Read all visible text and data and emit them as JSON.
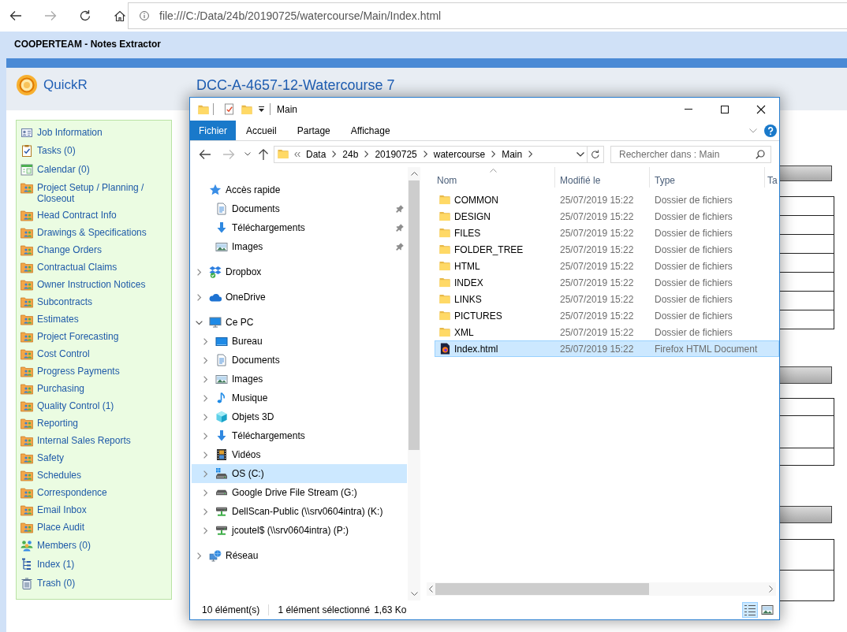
{
  "browser": {
    "url": "file:///C:/Data/24b/20190725/watercourse/Main/Index.html"
  },
  "app": {
    "title": "COOPERTEAM - Notes Extractor",
    "logo_text": "QuickR",
    "project_title": "DCC-A-4657-12-Watercourse 7"
  },
  "sidebar": {
    "items": [
      {
        "label": "Job Information",
        "kind": "job"
      },
      {
        "label": "Tasks (0)",
        "kind": "tasks"
      },
      {
        "label": "Calendar (0)",
        "kind": "calendar"
      },
      {
        "label": "Project Setup / Planning / Closeout",
        "kind": "module"
      },
      {
        "label": "Head Contract Info",
        "kind": "module"
      },
      {
        "label": "Drawings & Specifications",
        "kind": "module"
      },
      {
        "label": "Change Orders",
        "kind": "module"
      },
      {
        "label": "Contractual Claims",
        "kind": "module"
      },
      {
        "label": "Owner Instruction Notices",
        "kind": "module"
      },
      {
        "label": "Subcontracts",
        "kind": "module"
      },
      {
        "label": "Estimates",
        "kind": "module"
      },
      {
        "label": "Project Forecasting",
        "kind": "module"
      },
      {
        "label": "Cost Control",
        "kind": "module"
      },
      {
        "label": "Progress Payments",
        "kind": "module"
      },
      {
        "label": "Purchasing",
        "kind": "module"
      },
      {
        "label": "Quality Control (1)",
        "kind": "module"
      },
      {
        "label": "Reporting",
        "kind": "module"
      },
      {
        "label": "Internal Sales Reports",
        "kind": "module"
      },
      {
        "label": "Safety",
        "kind": "module"
      },
      {
        "label": "Schedules",
        "kind": "module"
      },
      {
        "label": "Correspondence",
        "kind": "module"
      },
      {
        "label": "Email Inbox",
        "kind": "module"
      },
      {
        "label": "Place Audit",
        "kind": "module"
      },
      {
        "label": "Members (0)",
        "kind": "members"
      },
      {
        "label": "Index (1)",
        "kind": "index"
      },
      {
        "label": "Trash (0)",
        "kind": "trash"
      }
    ]
  },
  "explorer": {
    "title": "Main",
    "ribbon_tabs": [
      {
        "label": "Fichier",
        "kind": "file",
        "selected": false
      },
      {
        "label": "Accueil",
        "kind": "tab",
        "selected": false
      },
      {
        "label": "Partage",
        "kind": "tab",
        "selected": false
      },
      {
        "label": "Affichage",
        "kind": "tab",
        "selected": false
      }
    ],
    "breadcrumb": [
      "Data",
      "24b",
      "20190725",
      "watercourse",
      "Main"
    ],
    "search": {
      "placeholder": "Rechercher dans : Main"
    },
    "navigation": {
      "quick_access": {
        "label": "Accès rapide",
        "selected": false,
        "items": [
          {
            "label": "Documents",
            "kind": "documents",
            "pinned": true,
            "selected": false
          },
          {
            "label": "Téléchargements",
            "kind": "downloads",
            "pinned": true,
            "selected": false
          },
          {
            "label": "Images",
            "kind": "pictures",
            "pinned": true,
            "selected": false
          }
        ]
      },
      "locations": [
        {
          "label": "Dropbox",
          "kind": "dropbox",
          "expanded": false,
          "selected": false
        },
        {
          "label": "OneDrive",
          "kind": "onedrive",
          "expanded": false,
          "selected": false
        },
        {
          "label": "Ce PC",
          "kind": "this_pc",
          "expanded": true,
          "selected": false,
          "children": [
            {
              "label": "Bureau",
              "kind": "desktop",
              "expanded": false,
              "selected": false
            },
            {
              "label": "Documents",
              "kind": "documents",
              "expanded": false,
              "selected": false
            },
            {
              "label": "Images",
              "kind": "pictures",
              "expanded": false,
              "selected": false
            },
            {
              "label": "Musique",
              "kind": "music",
              "expanded": false,
              "selected": false
            },
            {
              "label": "Objets 3D",
              "kind": "objects_3d",
              "expanded": false,
              "selected": false
            },
            {
              "label": "Téléchargements",
              "kind": "downloads",
              "expanded": false,
              "selected": false
            },
            {
              "label": "Vidéos",
              "kind": "videos",
              "expanded": false,
              "selected": false
            },
            {
              "label": "OS (C:)",
              "kind": "system_drive",
              "expanded": false,
              "selected": true
            },
            {
              "label": "Google Drive File Stream (G:)",
              "kind": "drive",
              "expanded": false,
              "selected": false
            },
            {
              "label": "DellScan-Public (\\\\srv0604intra) (K:)",
              "kind": "network_drive",
              "expanded": false,
              "selected": false
            },
            {
              "label": "jcoutel$ (\\\\srv0604intra) (P:)",
              "kind": "network_drive",
              "expanded": false,
              "selected": false
            }
          ]
        },
        {
          "label": "Réseau",
          "kind": "network",
          "expanded": false,
          "selected": false
        }
      ]
    },
    "columns": [
      {
        "label": "Nom",
        "sorted": true
      },
      {
        "label": "Modifié le",
        "sorted": false
      },
      {
        "label": "Type",
        "sorted": false
      },
      {
        "label": "Ta",
        "sorted": false
      }
    ],
    "files": [
      {
        "name": "COMMON",
        "modified": "25/07/2019 15:22",
        "type": "Dossier de fichiers",
        "kind": "folder",
        "selected": false
      },
      {
        "name": "DESIGN",
        "modified": "25/07/2019 15:22",
        "type": "Dossier de fichiers",
        "kind": "folder",
        "selected": false
      },
      {
        "name": "FILES",
        "modified": "25/07/2019 15:22",
        "type": "Dossier de fichiers",
        "kind": "folder",
        "selected": false
      },
      {
        "name": "FOLDER_TREE",
        "modified": "25/07/2019 15:22",
        "type": "Dossier de fichiers",
        "kind": "folder",
        "selected": false
      },
      {
        "name": "HTML",
        "modified": "25/07/2019 15:22",
        "type": "Dossier de fichiers",
        "kind": "folder",
        "selected": false
      },
      {
        "name": "INDEX",
        "modified": "25/07/2019 15:22",
        "type": "Dossier de fichiers",
        "kind": "folder",
        "selected": false
      },
      {
        "name": "LINKS",
        "modified": "25/07/2019 15:22",
        "type": "Dossier de fichiers",
        "kind": "folder",
        "selected": false
      },
      {
        "name": "PICTURES",
        "modified": "25/07/2019 15:22",
        "type": "Dossier de fichiers",
        "kind": "folder",
        "selected": false
      },
      {
        "name": "XML",
        "modified": "25/07/2019 15:22",
        "type": "Dossier de fichiers",
        "kind": "folder",
        "selected": false
      },
      {
        "name": "Index.html",
        "modified": "25/07/2019 15:22",
        "type": "Firefox HTML Document",
        "kind": "html",
        "selected": true
      }
    ],
    "status": {
      "item_count": "10 élément(s)",
      "selection": "1 élément sélectionné",
      "size": "1,63 Ko"
    },
    "views": [
      {
        "kind": "details",
        "selected": true
      },
      {
        "kind": "large_icons",
        "selected": false
      }
    ]
  }
}
